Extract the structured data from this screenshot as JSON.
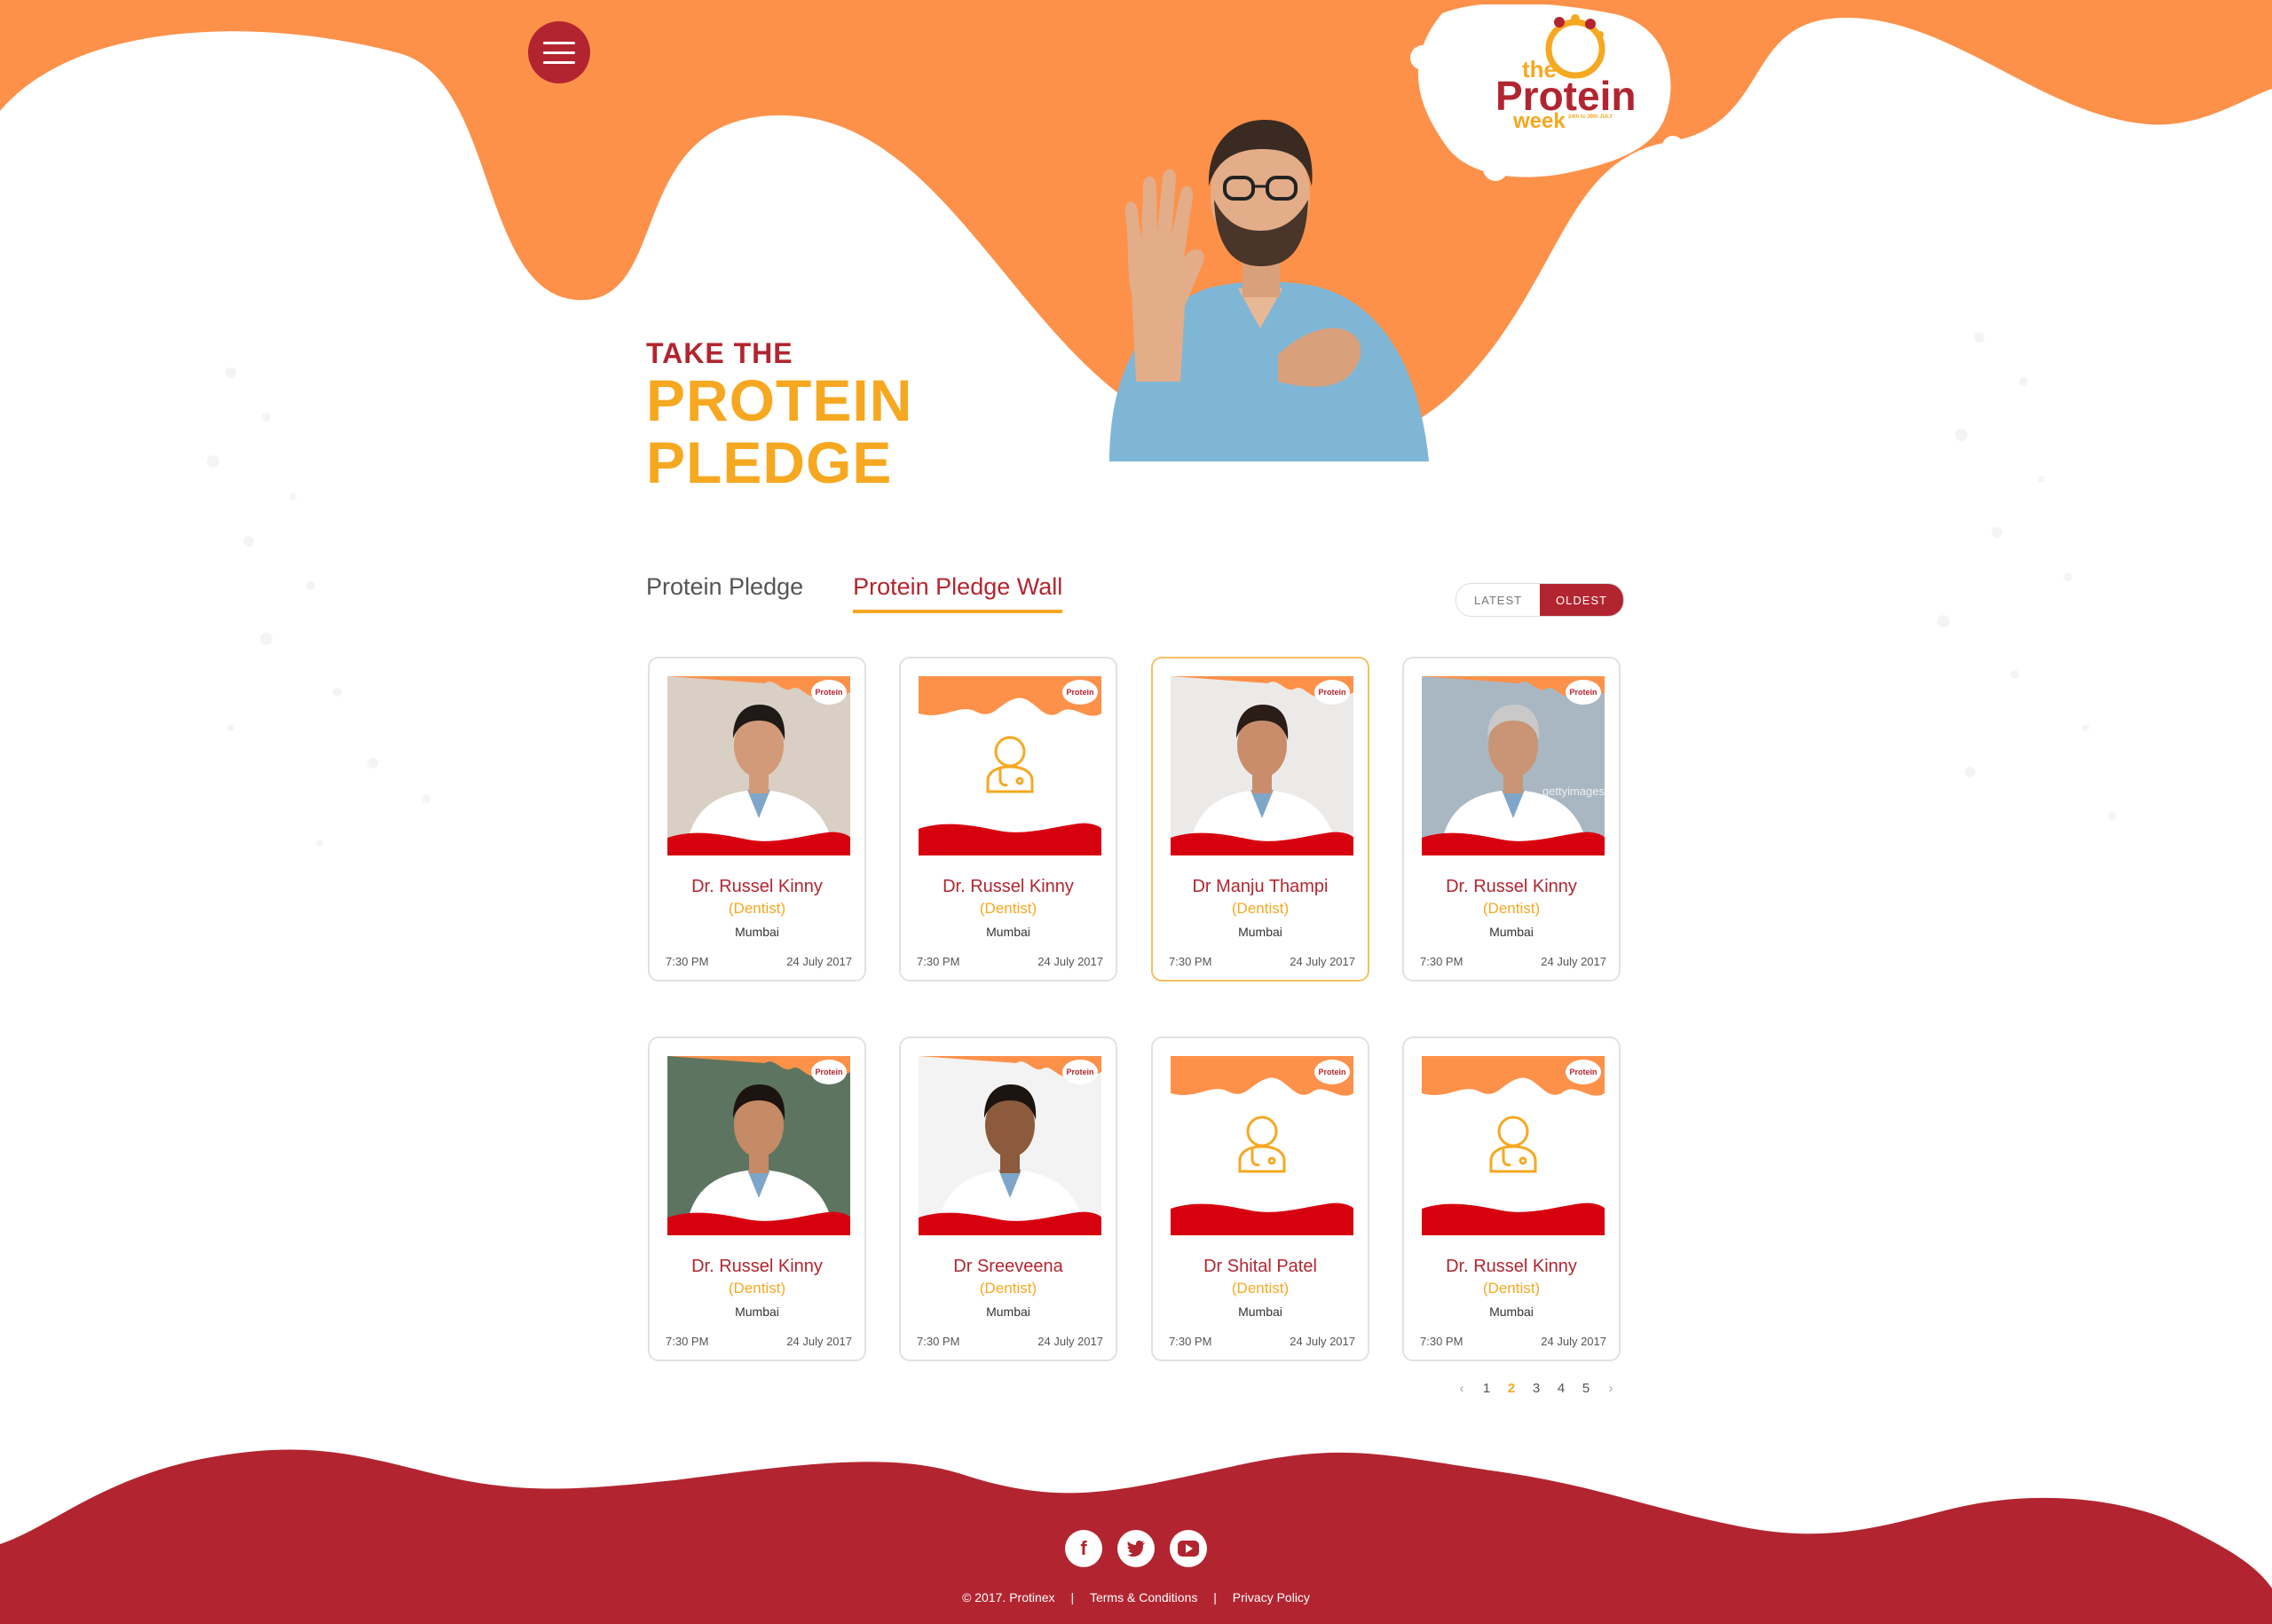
{
  "brand": {
    "logo_the": "the",
    "logo_main": "Protein",
    "logo_week": "week",
    "logo_dates": "24th to 30th JULY",
    "card_logo": "Protein",
    "primary": "#b22530",
    "accent": "#f6a821",
    "orange": "#fd914a"
  },
  "hero": {
    "line1": "TAKE THE",
    "line2": "PROTEIN",
    "line3": "PLEDGE"
  },
  "tabs": [
    {
      "label": "Protein Pledge",
      "active": false
    },
    {
      "label": "Protein Pledge Wall",
      "active": true
    }
  ],
  "sort": {
    "latest": "LATEST",
    "oldest": "OLDEST",
    "selected": "OLDEST"
  },
  "cards": [
    {
      "name": "Dr. Russel Kinny",
      "specialty": "(Dentist)",
      "city": "Mumbai",
      "time": "7:30 PM",
      "date": "24 July 2017",
      "photo": "man-lab-coat"
    },
    {
      "name": "Dr. Russel Kinny",
      "specialty": "(Dentist)",
      "city": "Mumbai",
      "time": "7:30 PM",
      "date": "24 July 2017",
      "photo": "placeholder"
    },
    {
      "name": "Dr Manju Thampi",
      "specialty": "(Dentist)",
      "city": "Mumbai",
      "time": "7:30 PM",
      "date": "24 July 2017",
      "photo": "woman-doctor"
    },
    {
      "name": "Dr. Russel Kinny",
      "specialty": "(Dentist)",
      "city": "Mumbai",
      "time": "7:30 PM",
      "date": "24 July 2017",
      "photo": "senior-doctor",
      "watermark": "gettyimages"
    },
    {
      "name": "Dr. Russel Kinny",
      "specialty": "(Dentist)",
      "city": "Mumbai",
      "time": "7:30 PM",
      "date": "24 July 2017",
      "photo": "woman-smiling"
    },
    {
      "name": "Dr Sreeveena",
      "specialty": "(Dentist)",
      "city": "Mumbai",
      "time": "7:30 PM",
      "date": "24 July 2017",
      "photo": "woman-doctor-2"
    },
    {
      "name": "Dr Shital Patel",
      "specialty": "(Dentist)",
      "city": "Mumbai",
      "time": "7:30 PM",
      "date": "24 July 2017",
      "photo": "placeholder"
    },
    {
      "name": "Dr. Russel Kinny",
      "specialty": "(Dentist)",
      "city": "Mumbai",
      "time": "7:30 PM",
      "date": "24 July 2017",
      "photo": "placeholder"
    }
  ],
  "pagination": {
    "pages": [
      "1",
      "2",
      "3",
      "4",
      "5"
    ],
    "current": "2",
    "prev": "‹",
    "next": "›"
  },
  "footer": {
    "copyright": "© 2017. Protinex",
    "separator": "|",
    "terms": "Terms & Conditions",
    "privacy": "Privacy Policy",
    "social": [
      "facebook-icon",
      "twitter-icon",
      "youtube-icon"
    ],
    "facebook_glyph": "f"
  }
}
